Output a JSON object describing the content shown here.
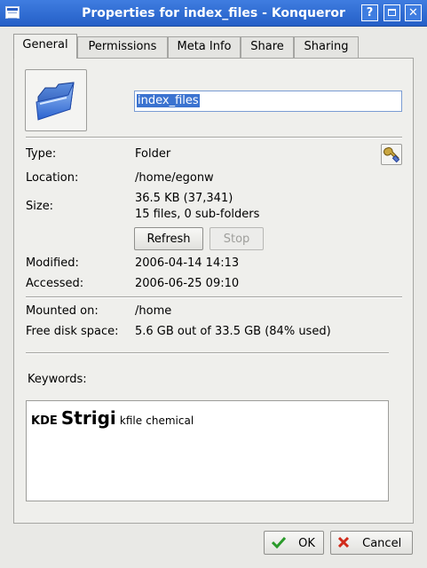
{
  "window": {
    "title": "Properties for index_files - Konqueror",
    "help_glyph": "?",
    "close_glyph": "✕"
  },
  "tabs": [
    {
      "label": "General",
      "active": true
    },
    {
      "label": "Permissions"
    },
    {
      "label": "Meta Info"
    },
    {
      "label": "Share"
    },
    {
      "label": "Sharing"
    }
  ],
  "general": {
    "name_value": "index_files",
    "type_label": "Type:",
    "type_value": "Folder",
    "location_label": "Location:",
    "location_value": "/home/egonw",
    "size_label": "Size:",
    "size_value": "36.5 KB (37,341)",
    "size_detail": "15 files, 0 sub-folders",
    "refresh_label": "Refresh",
    "stop_label": "Stop",
    "modified_label": "Modified:",
    "modified_value": "2006-04-14 14:13",
    "accessed_label": "Accessed:",
    "accessed_value": "2006-06-25 09:10",
    "mounted_label": "Mounted on:",
    "mounted_value": "/home",
    "free_label": "Free disk space:",
    "free_value": "5.6 GB out of 33.5 GB (84% used)",
    "keywords_label": "Keywords:",
    "keywords": {
      "kde": "KDE",
      "strigi": "Strigi",
      "kfile": "kfile",
      "chemical": "chemical"
    }
  },
  "footer": {
    "ok_label": "OK",
    "cancel_label": "Cancel"
  },
  "colors": {
    "titlebar": "#2f6ad8",
    "selection": "#3b73d0",
    "ok_check": "#2a9a2a",
    "cancel_x": "#d12a1a"
  }
}
